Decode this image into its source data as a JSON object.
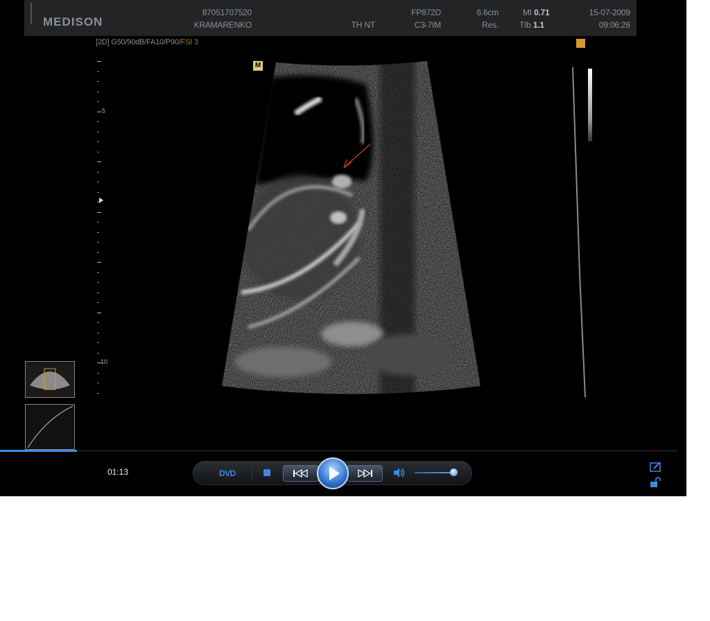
{
  "header": {
    "brand": "MEDISON",
    "patient_id": "87051707520",
    "patient_name": "KRAMARENKO",
    "exam": "TH NT",
    "probe_model": "FP872D",
    "probe_type": "C3-7IM",
    "depth": "6.6cm",
    "res_label": "Res.",
    "mi_label": "MI",
    "mi_value": "0.71",
    "tib_label": "TIb",
    "tib_value": "1.1",
    "date": "15-07-2009",
    "time": "09:06:26"
  },
  "imaging_params": {
    "main": "[2D] G50/90dB/FA10/P90/",
    "fsi": "FSI 3"
  },
  "scale": {
    "label_5": "5",
    "label_10": "10"
  },
  "orientation_marker": "M",
  "player": {
    "elapsed": "01:13",
    "dvd_label": "DVD",
    "progress": 0.113,
    "volume": 0.9
  },
  "colors": {
    "accent": "#3f88e0",
    "annotation_arrow": "#d83a2a"
  },
  "icons": [
    "stop-icon",
    "previous-icon",
    "play-icon",
    "next-icon",
    "volume-icon",
    "edit-icon",
    "lock-icon"
  ]
}
